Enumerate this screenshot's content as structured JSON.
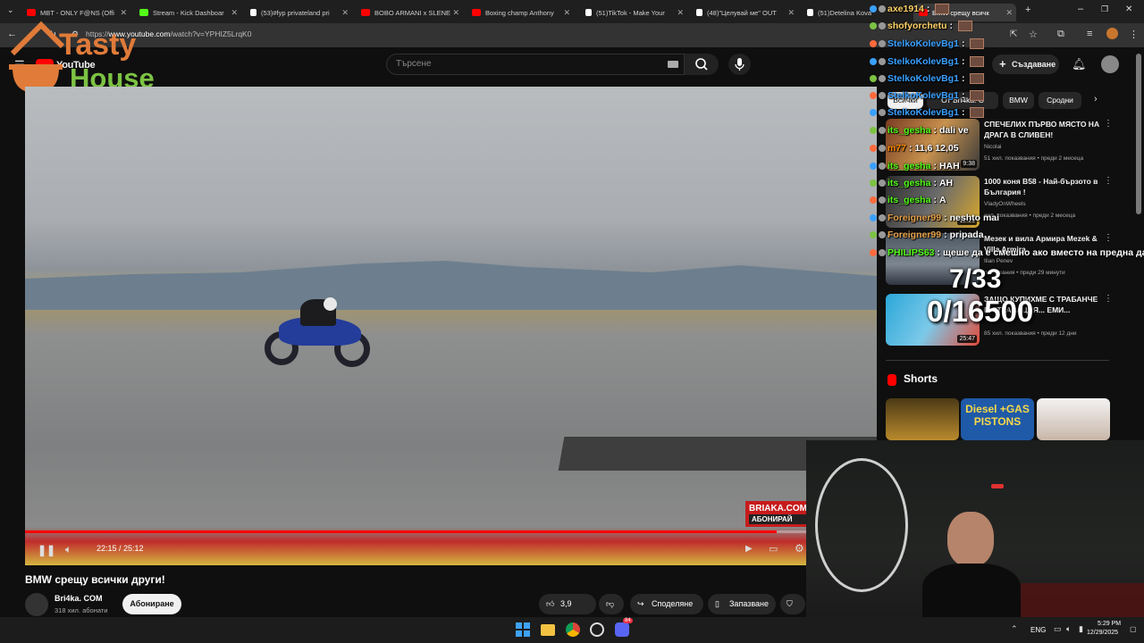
{
  "browser": {
    "tabs": [
      {
        "label": "MBT - ONLY F@NS (Offi",
        "favicon": "youtube",
        "color": "#ff0000"
      },
      {
        "label": "Stream - Kick Dashboar",
        "favicon": "kick",
        "color": "#53fc18"
      },
      {
        "label": "(53)#fyp privateland pri",
        "favicon": "tiktok",
        "color": "#ffffff"
      },
      {
        "label": "BOBO ARMANI x SLENE",
        "favicon": "youtube",
        "color": "#ff0000"
      },
      {
        "label": "Boxing champ Anthony",
        "favicon": "youtube",
        "color": "#ff0000"
      },
      {
        "label": "(51)TikTok - Make Your",
        "favicon": "tiktok",
        "color": "#ffffff"
      },
      {
        "label": "(48)\"Целувай ме\" OUT",
        "favicon": "tiktok",
        "color": "#ffffff"
      },
      {
        "label": "(51)Detelina Kova",
        "favicon": "tiktok",
        "color": "#ffffff"
      },
      {
        "label": "BMW срещу всичк",
        "favicon": "youtube",
        "color": "#ff0000",
        "active": true
      }
    ],
    "url_prefix": "https://",
    "url_host": "www.youtube.com",
    "url_path": "/watch?v=YPHIZ5LrqK0"
  },
  "overlay_logo": {
    "line1": "Tasty",
    "line2": "House"
  },
  "youtube": {
    "logo_text": "YouTube",
    "search_placeholder": "Търсене",
    "create_label": "Създаване",
    "video": {
      "time": "22:15 / 25:12",
      "progress": 0.883,
      "title": "BMW срещу всички други!",
      "watermark": "BRIAKA.COM",
      "watermark_sub": "АБОНИРАЙ"
    },
    "channel": {
      "name": "Bri4ka. COM",
      "subs": "318 хил. абонати",
      "subscribe_label": "Абониране"
    },
    "actions": {
      "likes": "3,9 хил.",
      "share": "Споделяне",
      "save": "Запазване"
    },
    "chips": [
      "Всички",
      "От Bri4ka. C",
      "BMW",
      "Сродни"
    ],
    "recommendations": [
      {
        "title": "СПЕЧЕЛИХ ПЪРВО МЯСТО НА ДРАГА В СЛИВЕН!",
        "channel": "Nicolai",
        "meta": "51 хил. показвания • преди 2 месеца",
        "duration": "9:38"
      },
      {
        "title": "1000 коня B58 - Най-бързото в България !",
        "channel": "VladyOnWheels",
        "meta": "хил. показвания • преди 2 месеца",
        "duration": "12:21"
      },
      {
        "title": "Мезек и вила Армира Mezek & Villa Armira",
        "channel": "Ilian Penev",
        "meta": "показвания • преди 29 минути",
        "duration": ""
      },
      {
        "title": "ЗАЩО КУПИХМЕ С ТРАБАНЧЕ В СТРАВАЦИЯ... ЕМИ...",
        "channel": "",
        "meta": "85 хил. показвания • преди 12 дни",
        "duration": "25:47"
      }
    ],
    "shorts_label": "Shorts",
    "shorts": [
      "",
      "Diesel +GAS PISTONS",
      ""
    ]
  },
  "chat": [
    {
      "user": "axe1914",
      "message": "",
      "color": "#ffd166",
      "emote": true
    },
    {
      "user": "shofyorchetu",
      "message": "",
      "color": "#ffd166",
      "emote": true
    },
    {
      "user": "StelkoKolevBg1",
      "message": "",
      "color": "#3aa0ff",
      "emote": true
    },
    {
      "user": "StelkoKolevBg1",
      "message": "",
      "color": "#3aa0ff",
      "emote": true
    },
    {
      "user": "StelkoKolevBg1",
      "message": "",
      "color": "#3aa0ff",
      "emote": true
    },
    {
      "user": "StelkoKolevBg1",
      "message": "",
      "color": "#3aa0ff",
      "emote": true
    },
    {
      "user": "StelkoKolevBg1",
      "message": "",
      "color": "#3aa0ff",
      "emote": true
    },
    {
      "user": "its_gesha",
      "message": "dali ve",
      "color": "#53fc18",
      "emote": false
    },
    {
      "user": "m77",
      "message": "11,6 12,05",
      "color": "#ff8c00",
      "emote": false
    },
    {
      "user": "its_gesha",
      "message": "НАН",
      "color": "#53fc18",
      "emote": false
    },
    {
      "user": "its_gesha",
      "message": "АН",
      "color": "#53fc18",
      "emote": false
    },
    {
      "user": "its_gesha",
      "message": "А",
      "color": "#53fc18",
      "emote": false
    },
    {
      "user": "Foreigner99",
      "message": "neshto mai",
      "color": "#e5a14a",
      "emote": false
    },
    {
      "user": "Foreigner99",
      "message": "pripada",
      "color": "#e5a14a",
      "emote": false
    },
    {
      "user": "PHILIPS63",
      "message": "щеше да е смешно ако вместо на предна да",
      "color": "#53fc18",
      "emote": false
    }
  ],
  "stream_counters": {
    "follow_goal": "7/33",
    "sub_goal": "0/16500"
  },
  "taskbar": {
    "lang": "ENG",
    "time": "5:29 PM",
    "date": "12/29/2025",
    "discord_badge": "84"
  }
}
